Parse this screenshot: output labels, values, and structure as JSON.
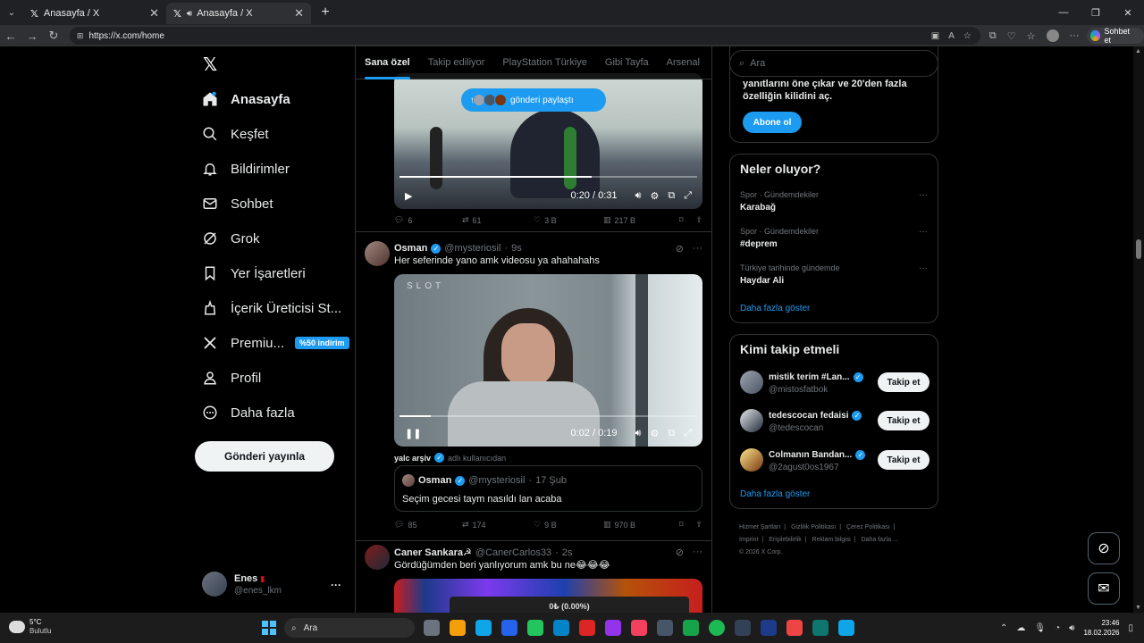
{
  "browser": {
    "tabs": [
      {
        "title": "Anasayfa / X",
        "active": false
      },
      {
        "title": "Anasayfa / X",
        "active": true
      }
    ],
    "url": "https://x.com/home",
    "sohbet_label": "Sohbet et"
  },
  "sidebar": {
    "items": [
      {
        "label": "Anasayfa",
        "icon": "home-icon",
        "active": true
      },
      {
        "label": "Keşfet",
        "icon": "search-icon"
      },
      {
        "label": "Bildirimler",
        "icon": "bell-icon"
      },
      {
        "label": "Sohbet",
        "icon": "mail-icon"
      },
      {
        "label": "Grok",
        "icon": "grok-icon"
      },
      {
        "label": "Yer İşaretleri",
        "icon": "bookmark-icon"
      },
      {
        "label": "İçerik Üreticisi St...",
        "icon": "creator-studio-icon"
      },
      {
        "label": "Premiu...",
        "icon": "x-premium-icon",
        "badge": "%50 indirim"
      },
      {
        "label": "Profil",
        "icon": "person-icon"
      },
      {
        "label": "Daha fazla",
        "icon": "more-circle-icon"
      }
    ],
    "post_button": "Gönderi yayınla",
    "account": {
      "name": "Enes",
      "handle": "@enes_lkm"
    }
  },
  "timeline": {
    "tabs": [
      "Sana özel",
      "Takip ediliyor",
      "PlayStation Türkiye",
      "Gibi Tayfa",
      "Arsenal"
    ],
    "active_tab": "Sana özel",
    "share_pill": "gönderi paylaştı",
    "top_video": {
      "time": "0:20 / 0:31",
      "progress": 0.645
    },
    "top_actions": {
      "replies": "6",
      "reposts": "61",
      "likes": "3 B",
      "views": "217 B"
    },
    "post1": {
      "name": "Osman",
      "handle": "@mysteriosil",
      "age": "9s",
      "text": "Her seferinde yano amk videosu ya ahahahahs",
      "video": {
        "watermark": "SLOT",
        "time": "0:02 / 0:19",
        "progress": 0.105
      },
      "quote_source": {
        "name": "yalc arşiv",
        "note": "adlı kullanıcıdan"
      },
      "quote": {
        "name": "Osman",
        "handle": "@mysteriosil",
        "date": "17 Şub",
        "text": "Seçim gecesi taym nasıldı lan acaba"
      },
      "actions": {
        "replies": "85",
        "reposts": "174",
        "likes": "9 B",
        "views": "970 B"
      }
    },
    "post2": {
      "name": "Caner Sankara☭",
      "handle": "@CanerCarlos33",
      "age": "2s",
      "text": "Gördüğümden beri yanlıyorum amk bu ne😂😂😂"
    }
  },
  "right": {
    "search_placeholder": "Ara",
    "premium_text": "yanıtlarını öne çıkar ve 20'den fazla özelliğin kilidini aç.",
    "subscribe": "Abone ol",
    "trends_title": "Neler oluyor?",
    "trends": [
      {
        "context": "Spor · Gündemdekiler",
        "title": "Karabağ"
      },
      {
        "context": "Spor · Gündemdekiler",
        "title": "#deprem"
      },
      {
        "context": "Türkiye tarihinde gündemde",
        "title": "Haydar Ali"
      }
    ],
    "show_more": "Daha fazla göster",
    "who_title": "Kimi takip etmeli",
    "who": [
      {
        "name": "mistik terim #Lan...",
        "handle": "@mistosfatbok"
      },
      {
        "name": "tedescocan fedaisi",
        "handle": "@tedescocan"
      },
      {
        "name": "Colmanın Bandan...",
        "handle": "@2agust0os1967"
      }
    ],
    "follow_label": "Takip et",
    "footer": [
      "Hizmet Şartları",
      "Gizlilik Politikası",
      "Çerez Politikası",
      "Imprint",
      "Erişilebilirlik",
      "Reklam bilgisi",
      "Daha fazla ...",
      "© 2026 X Corp."
    ]
  },
  "taskbar": {
    "temp": "5°C",
    "weather": "Bulutlu",
    "search": "Ara",
    "speed": "0₺ (0.00%)",
    "time": "23:46",
    "date": "18.02.2026"
  },
  "colors": {
    "accent": "#1d9bf0",
    "background": "#000000",
    "border": "#2f3336",
    "muted": "#71767b"
  }
}
